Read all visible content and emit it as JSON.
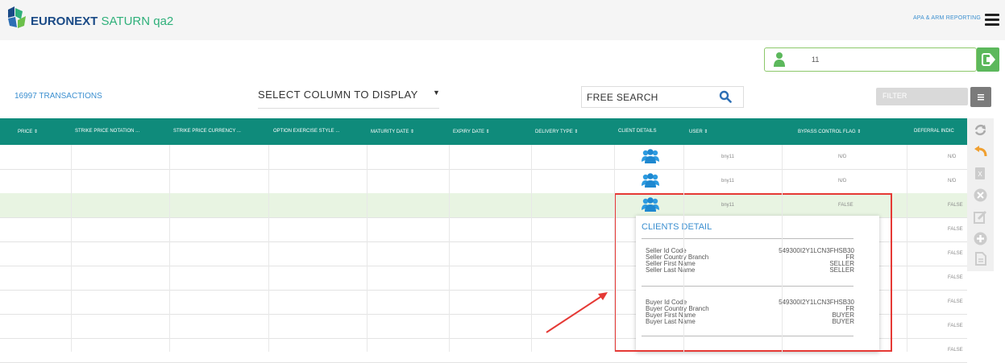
{
  "header": {
    "brand_name": "EURONEXT",
    "brand_sub": "SATURN qa2",
    "apa_link": "APA & ARM REPORTING"
  },
  "user_box": {
    "value": "11"
  },
  "toolbar": {
    "transactions": "16997 TRANSACTIONS",
    "select_column": "SELECT COLUMN TO DISPLAY",
    "search_placeholder": "FREE SEARCH",
    "filter_placeholder": "FILTER"
  },
  "table": {
    "columns": [
      "PRICE",
      "STRIKE PRICE NOTATION ...",
      "STRIKE PRICE CURRENCY ...",
      "OPTION EXERCISE STYLE ...",
      "MATURITY DATE",
      "EXPIRY DATE",
      "DELIVERY TYPE",
      "CLIENT DETAILS",
      "USER",
      "BYPASS CONTROL FLAG",
      "DEFERRAL INDIC"
    ],
    "rows": [
      {
        "user": "bny11",
        "bypass": "N/D",
        "deferral": "N/D"
      },
      {
        "user": "bny11",
        "bypass": "N/D",
        "deferral": "N/D"
      },
      {
        "user": "bny11",
        "bypass": "FALSE",
        "deferral": "FALSE"
      },
      {
        "user": "",
        "bypass": "",
        "deferral": "FALSE"
      },
      {
        "user": "",
        "bypass": "",
        "deferral": "FALSE"
      },
      {
        "user": "",
        "bypass": "",
        "deferral": "FALSE"
      },
      {
        "user": "",
        "bypass": "",
        "deferral": "FALSE"
      },
      {
        "user": "",
        "bypass": "",
        "deferral": "FALSE"
      },
      {
        "user": "",
        "bypass": "",
        "deferral": "FALSE"
      }
    ]
  },
  "clients_popup": {
    "title": "CLIENTS DETAIL",
    "seller": [
      {
        "label": "Seller Id Code",
        "value": "549300I2Y1LCN3FHSB30"
      },
      {
        "label": "Seller Country Branch",
        "value": "FR"
      },
      {
        "label": "Seller First Name",
        "value": "SELLER"
      },
      {
        "label": "Seller Last Name",
        "value": "SELLER"
      }
    ],
    "buyer": [
      {
        "label": "Buyer Id Code",
        "value": "549300I2Y1LCN3FHSB30"
      },
      {
        "label": "Buyer Country Branch",
        "value": "FR"
      },
      {
        "label": "Buyer First Name",
        "value": "BUYER"
      },
      {
        "label": "Buyer Last Name",
        "value": "BUYER"
      }
    ]
  },
  "colors": {
    "header_bg": "#0f8b7b",
    "accent": "#3b8fd0",
    "highlight": "#e53935",
    "selected_row": "#e8f4e2"
  }
}
